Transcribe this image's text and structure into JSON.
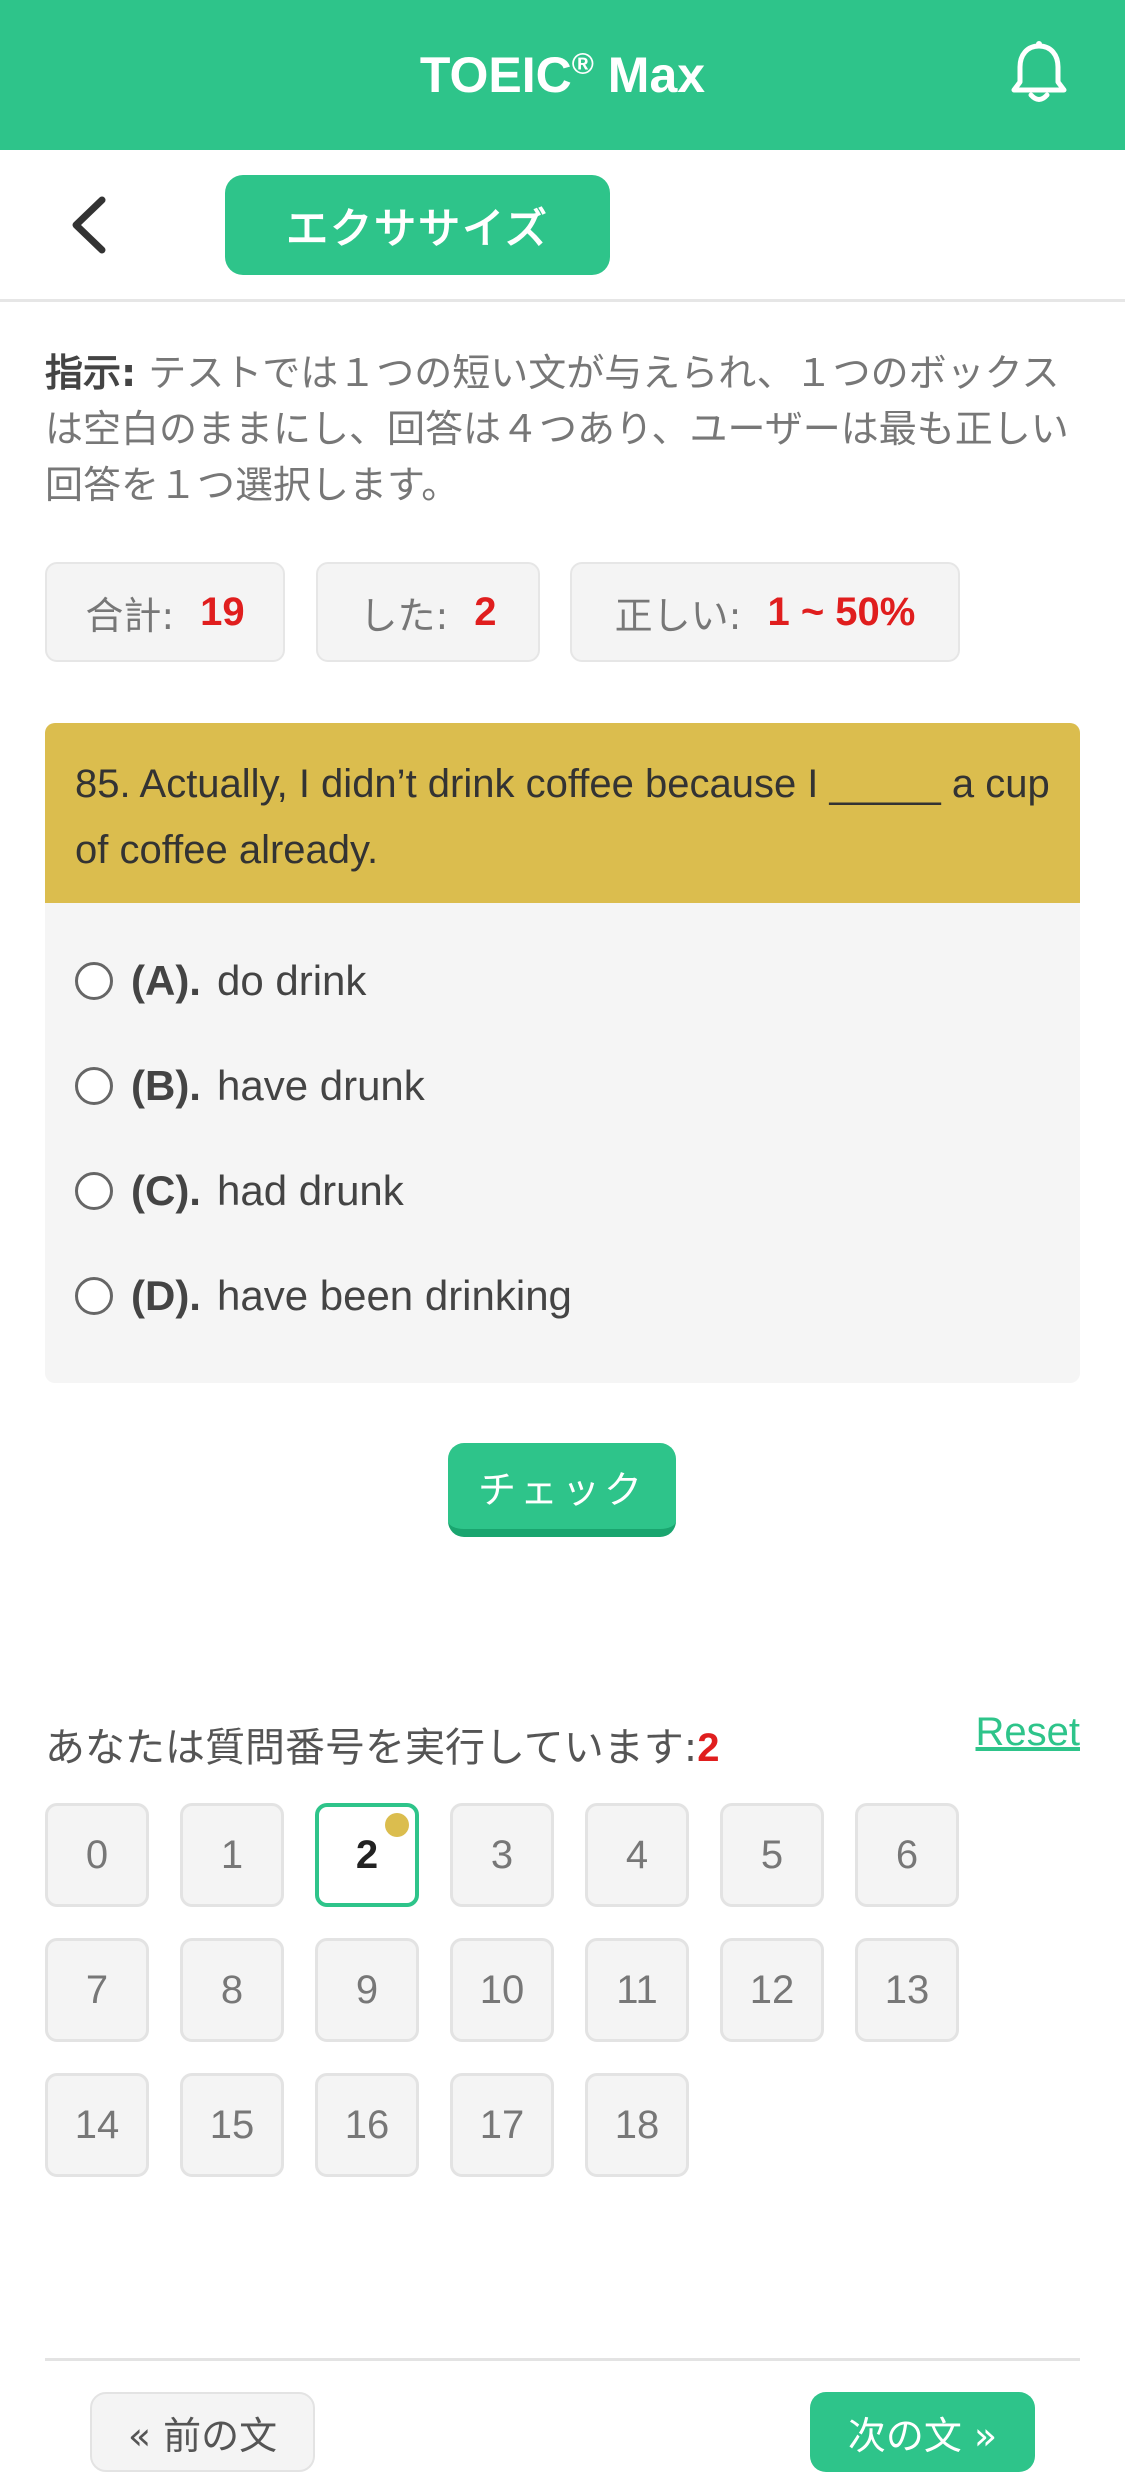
{
  "header": {
    "title_main": "TOEIC",
    "title_reg": "®",
    "title_tail": " Max",
    "bell_icon": "bell-icon"
  },
  "subbar": {
    "back_icon": "chevron-left-icon",
    "mode_label": "エクササイズ"
  },
  "instruction": {
    "label": "指示:",
    "text": " テストでは１つの短い文が与えられ、１つのボックスは空白のままにし、回答は４つあり、ユーザーは最も正しい回答を１つ選択します。"
  },
  "stats": {
    "total_label": "合計:",
    "total_value": "19",
    "done_label": "した:",
    "done_value": "2",
    "correct_label": "正しい:",
    "correct_value": "1 ~ 50%"
  },
  "question": {
    "text": "85. Actually, I didn’t drink coffee because I _____ a cup of coffee already.",
    "options": [
      {
        "letter": "(A).",
        "text": "do drink"
      },
      {
        "letter": "(B).",
        "text": "have drunk"
      },
      {
        "letter": "(C).",
        "text": "had drunk"
      },
      {
        "letter": "(D).",
        "text": "have been drinking"
      }
    ]
  },
  "check_label": "チェック",
  "progress": {
    "label": "あなたは質問番号を実行しています:",
    "current": "2",
    "reset_label": "Reset",
    "numbers": [
      "0",
      "1",
      "2",
      "3",
      "4",
      "5",
      "6",
      "7",
      "8",
      "9",
      "10",
      "11",
      "12",
      "13",
      "14",
      "15",
      "16",
      "17",
      "18"
    ]
  },
  "nav": {
    "prev_label": "« 前の文",
    "next_label": "次の文 »"
  },
  "colors": {
    "accent": "#2ec48a",
    "question_header": "#dbbd4e",
    "highlight_red": "#e01e1e"
  }
}
